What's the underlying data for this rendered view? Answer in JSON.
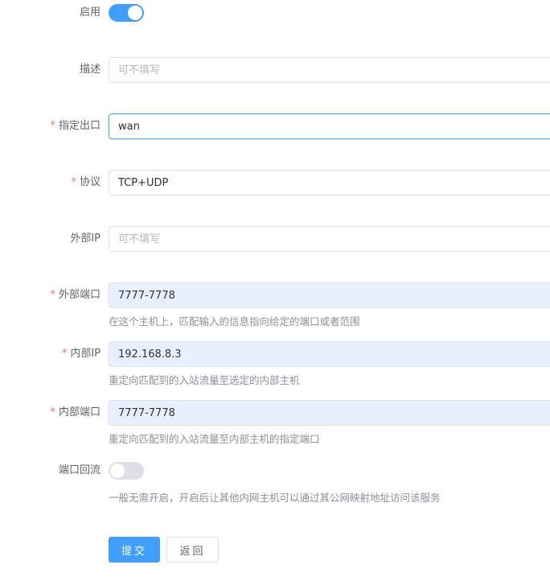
{
  "form": {
    "enable": {
      "label": "启用",
      "on": true
    },
    "description": {
      "label": "描述",
      "placeholder": "可不填写",
      "value": ""
    },
    "outbound": {
      "label": "指定出口",
      "value": "wan"
    },
    "protocol": {
      "label": "协议",
      "value": "TCP+UDP"
    },
    "external_ip": {
      "label": "外部IP",
      "placeholder": "可不填写",
      "value": ""
    },
    "external_port": {
      "label": "外部端口",
      "value": "7777-7778",
      "help": "在这个主机上，匹配输入的信息指向给定的端口或者范围"
    },
    "internal_ip": {
      "label": "内部IP",
      "value": "192.168.8.3",
      "help": "重定向匹配到的入站流量至选定的内部主机"
    },
    "internal_port": {
      "label": "内部端口",
      "value": "7777-7778",
      "help": "重定向匹配到的入站流量至内部主机的指定端口"
    },
    "loopback": {
      "label": "端口回流",
      "on": false,
      "help": "一般无需开启，开启后让其他内网主机可以通过其公网映射地址访问该服务"
    },
    "required_mark": "*"
  },
  "actions": {
    "submit_label": "提交",
    "back_label": "返回"
  },
  "colors": {
    "primary": "#409eff",
    "required": "#f56c6c",
    "autofill": "#e8f0fe"
  }
}
